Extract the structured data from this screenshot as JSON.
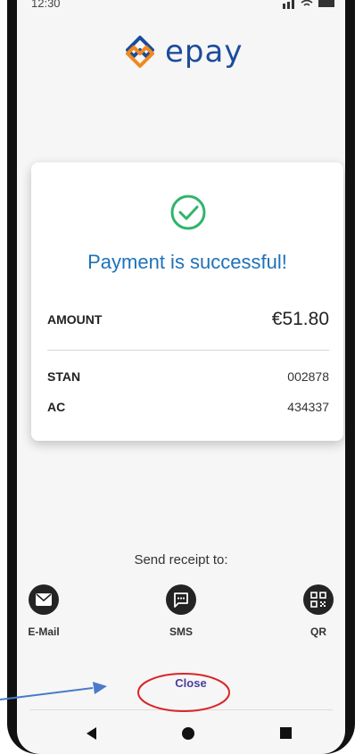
{
  "status_bar": {
    "time": "12:30"
  },
  "brand": {
    "name": "epay"
  },
  "payment_card": {
    "status_message": "Payment is successful!",
    "amount_label": "AMOUNT",
    "amount_value": "€51.80",
    "stan_label": "STAN",
    "stan_value": "002878",
    "ac_label": "AC",
    "ac_value": "434337"
  },
  "receipt": {
    "title": "Send receipt to:",
    "options": [
      {
        "label": "E-Mail",
        "icon": "mail-icon"
      },
      {
        "label": "SMS",
        "icon": "sms-icon"
      },
      {
        "label": "QR",
        "icon": "qr-code-icon"
      }
    ]
  },
  "actions": {
    "close_label": "Close"
  },
  "colors": {
    "brand_blue": "#1c4c9b",
    "brand_orange": "#f08a1c",
    "success_green": "#2fb56a",
    "title_blue": "#1e72b9",
    "close_purple": "#4b3d9e",
    "annotation_red": "#d9262a",
    "annotation_arrow_blue": "#4a7bc8"
  }
}
